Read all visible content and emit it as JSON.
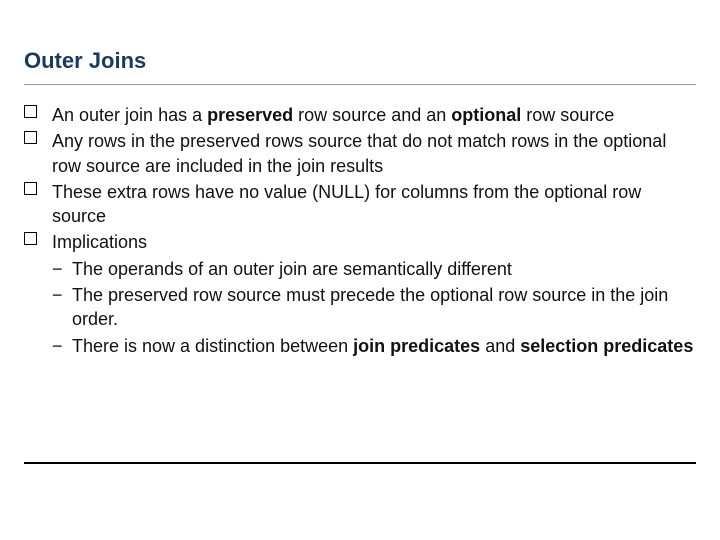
{
  "title": "Outer Joins",
  "bullets": [
    {
      "pre": "An outer join has a ",
      "b1": "preserved",
      "mid": " row source and an ",
      "b2": "optional",
      "post": " row source"
    },
    {
      "text": "Any rows in the preserved rows source that do not match rows in the optional row source are included in the join results"
    },
    {
      "text": "These extra rows have no value (NULL) for columns from the optional row source"
    },
    {
      "text": "Implications"
    }
  ],
  "subs": [
    {
      "text": "The operands of an outer join are semantically different"
    },
    {
      "text": "The preserved row source must precede the optional row source in the join order."
    },
    {
      "pre": "There is now a distinction between ",
      "b1": "join predicates",
      "mid": " and ",
      "b2": "selection predicates"
    }
  ],
  "sub_marker": "−"
}
